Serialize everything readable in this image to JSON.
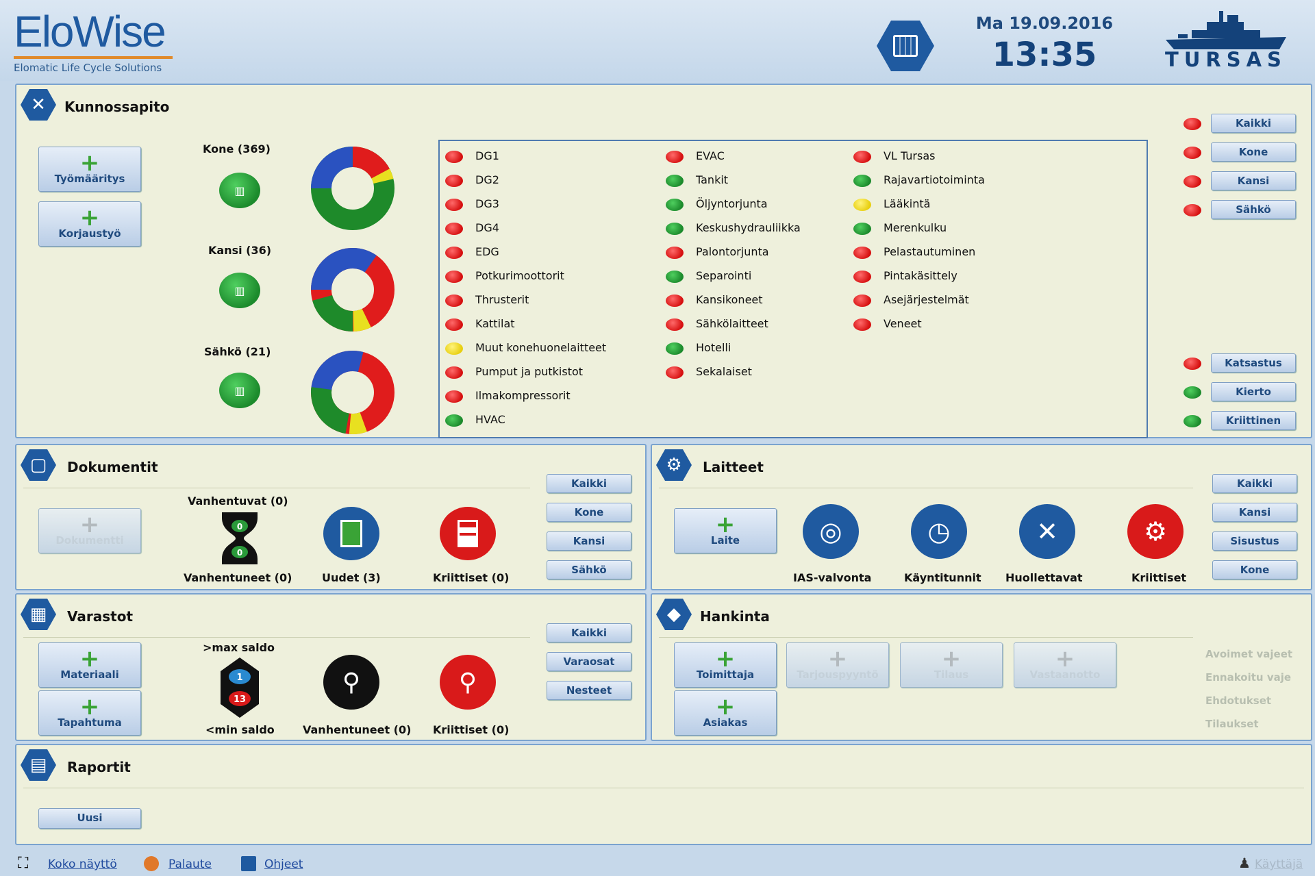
{
  "header": {
    "logo": "EloWise",
    "logo_sub": "Elomatic Life Cycle Solutions",
    "date": "Ma 19.09.2016",
    "time": "13:35",
    "brand": "TURSAS"
  },
  "kunnossapito": {
    "title": "Kunnossapito",
    "buttons": [
      "Työmääritys",
      "Korjaustyö"
    ],
    "groups": [
      {
        "label": "Kone (369)"
      },
      {
        "label": "Kansi (36)"
      },
      {
        "label": "Sähkö (21)"
      }
    ],
    "status_columns": [
      [
        {
          "label": "DG1",
          "color": "red"
        },
        {
          "label": "DG2",
          "color": "red"
        },
        {
          "label": "DG3",
          "color": "red"
        },
        {
          "label": "DG4",
          "color": "red"
        },
        {
          "label": "EDG",
          "color": "red"
        },
        {
          "label": "Potkurimoottorit",
          "color": "red"
        },
        {
          "label": "Thrusterit",
          "color": "red"
        },
        {
          "label": "Kattilat",
          "color": "red"
        },
        {
          "label": "Muut konehuonelaitteet",
          "color": "yellow"
        },
        {
          "label": "Pumput ja putkistot",
          "color": "red"
        },
        {
          "label": "Ilmakompressorit",
          "color": "red"
        },
        {
          "label": "HVAC",
          "color": "green"
        }
      ],
      [
        {
          "label": "EVAC",
          "color": "red"
        },
        {
          "label": "Tankit",
          "color": "green"
        },
        {
          "label": "Öljyntorjunta",
          "color": "green"
        },
        {
          "label": "Keskushydrauliikka",
          "color": "green"
        },
        {
          "label": "Palontorjunta",
          "color": "red"
        },
        {
          "label": "Separointi",
          "color": "green"
        },
        {
          "label": "Kansikoneet",
          "color": "red"
        },
        {
          "label": "Sähkölaitteet",
          "color": "red"
        },
        {
          "label": "Hotelli",
          "color": "green"
        },
        {
          "label": "Sekalaiset",
          "color": "red"
        }
      ],
      [
        {
          "label": "VL Tursas",
          "color": "red"
        },
        {
          "label": "Rajavartiotoiminta",
          "color": "green"
        },
        {
          "label": "Lääkintä",
          "color": "yellow"
        },
        {
          "label": "Merenkulku",
          "color": "green"
        },
        {
          "label": "Pelastautuminen",
          "color": "red"
        },
        {
          "label": "Pintakäsittely",
          "color": "red"
        },
        {
          "label": "Asejärjestelmät",
          "color": "red"
        },
        {
          "label": "Veneet",
          "color": "red"
        }
      ]
    ],
    "filters_top": [
      {
        "label": "Kaikki",
        "color": "red"
      },
      {
        "label": "Kone",
        "color": "red"
      },
      {
        "label": "Kansi",
        "color": "red"
      },
      {
        "label": "Sähkö",
        "color": "red"
      }
    ],
    "filters_bottom": [
      {
        "label": "Katsastus",
        "color": "red"
      },
      {
        "label": "Kierto",
        "color": "green"
      },
      {
        "label": "Kriittinen",
        "color": "green"
      }
    ]
  },
  "dokumentit": {
    "title": "Dokumentit",
    "add_button": "Dokumentti",
    "expiring": "Vanhentuvat (0)",
    "expired": "Vanhentuneet (0)",
    "hourglass_top": "0",
    "hourglass_bottom": "0",
    "new": "Uudet (3)",
    "critical": "Kriittiset (0)",
    "filters": [
      "Kaikki",
      "Kone",
      "Kansi",
      "Sähkö"
    ]
  },
  "laitteet": {
    "title": "Laitteet",
    "add_button": "Laite",
    "items": [
      "IAS-valvonta",
      "Käyntitunnit",
      "Huollettavat",
      "Kriittiset"
    ],
    "filters": [
      "Kaikki",
      "Kansi",
      "Sisustus",
      "Kone"
    ]
  },
  "varastot": {
    "title": "Varastot",
    "buttons": [
      "Materiaali",
      "Tapahtuma"
    ],
    "max_label": ">max saldo",
    "min_label": "<min saldo",
    "max_count": "1",
    "min_count": "13",
    "expired": "Vanhentuneet (0)",
    "critical": "Kriittiset (0)",
    "filters": [
      "Kaikki",
      "Varaosat",
      "Nesteet"
    ]
  },
  "hankinta": {
    "title": "Hankinta",
    "buttons": [
      "Toimittaja",
      "Asiakas"
    ],
    "disabled_buttons": [
      "Tarjouspyyntö",
      "Tilaus",
      "Vastaanotto"
    ],
    "status_links": [
      "Avoimet vajeet",
      "Ennakoitu vaje",
      "Ehdotukset",
      "Tilaukset"
    ]
  },
  "raportit": {
    "title": "Raportit",
    "button": "Uusi"
  },
  "footer": {
    "fullscreen": "Koko näyttö",
    "feedback": "Palaute",
    "help": "Ohjeet",
    "user": "Käyttäjä"
  }
}
